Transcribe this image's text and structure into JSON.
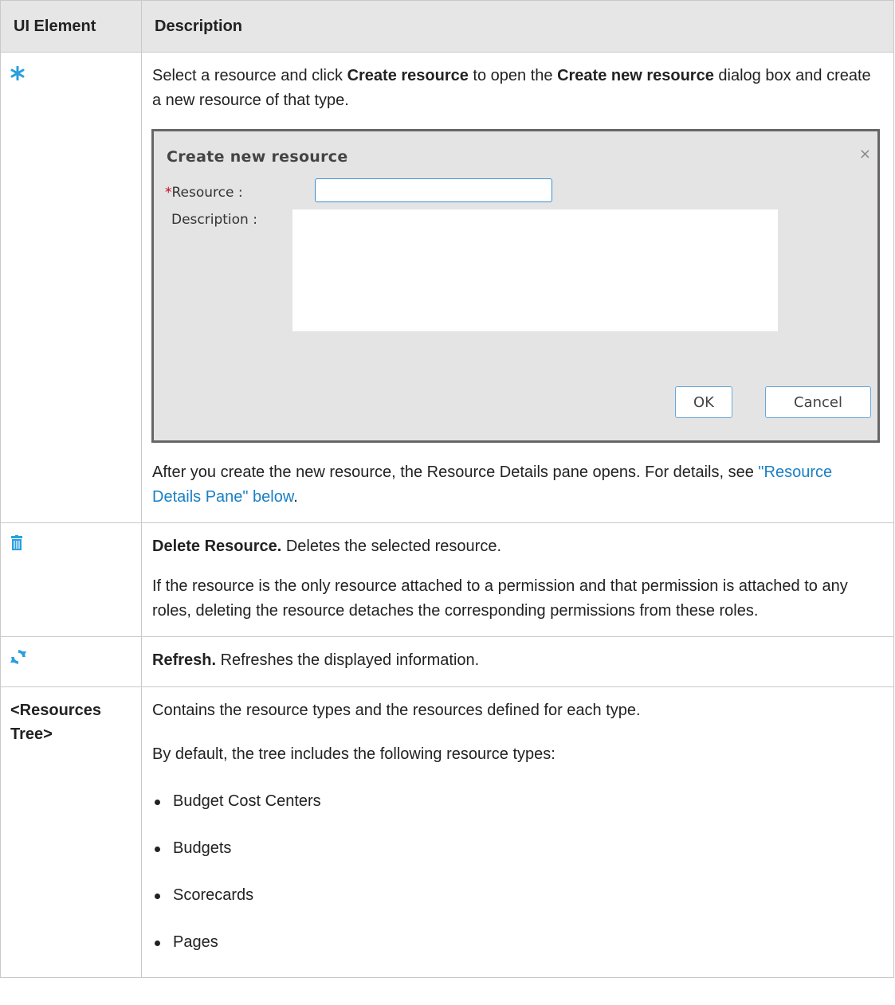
{
  "header": {
    "col1": "UI Element",
    "col2": "Description"
  },
  "rows": {
    "create": {
      "icon": "asterisk-icon",
      "intro_pre": "Select a resource and click ",
      "intro_bold1": "Create resource",
      "intro_mid": " to open the ",
      "intro_bold2": "Create new resource",
      "intro_post": " dialog box and create a new resource of that type.",
      "dialog": {
        "title": "Create new resource",
        "close": "×",
        "required_mark": "*",
        "resource_label": "Resource :",
        "description_label": "Description :",
        "ok": "OK",
        "cancel": "Cancel"
      },
      "after_pre": "After you create the new resource, the Resource Details pane opens. For details, see ",
      "after_link": "\"Resource Details Pane\" below",
      "after_post": "."
    },
    "delete": {
      "icon": "trash-icon",
      "title": "Delete Resource.",
      "text": " Deletes the selected resource.",
      "para2": "If the resource is the only resource attached to a permission and that permission is attached to any roles, deleting the resource detaches the corresponding permissions from these roles."
    },
    "refresh": {
      "icon": "refresh-icon",
      "title": "Refresh.",
      "text": " Refreshes the displayed information."
    },
    "tree": {
      "element": "<Resources Tree>",
      "para1": "Contains the resource types and the resources defined for each type.",
      "para2": "By default, the tree includes the following resource types:",
      "types": [
        "Budget Cost Centers",
        "Budgets",
        "Scorecards",
        "Pages"
      ]
    }
  },
  "colors": {
    "header_bg": "#e6e6e6",
    "link": "#1a80c4",
    "icon_blue": "#2a9fe0"
  }
}
